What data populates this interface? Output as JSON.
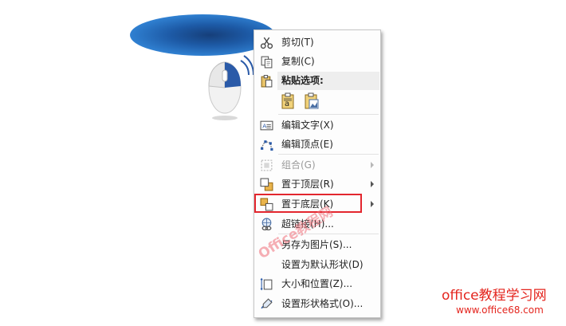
{
  "menu": {
    "items": [
      {
        "label": "剪切(T)",
        "icon": "scissors-icon",
        "enabled": true
      },
      {
        "label": "复制(C)",
        "icon": "copy-icon",
        "enabled": true
      },
      {
        "label": "粘贴选项:",
        "icon": "paste-icon"
      },
      {
        "label": "编辑文字(X)",
        "icon": "edit-text-icon",
        "enabled": true
      },
      {
        "label": "编辑顶点(E)",
        "icon": "edit-points-icon",
        "enabled": true
      },
      {
        "label": "组合(G)",
        "icon": "group-icon",
        "enabled": false,
        "submenu": true
      },
      {
        "label": "置于顶层(R)",
        "icon": "bring-to-front-icon",
        "enabled": true,
        "submenu": true
      },
      {
        "label": "置于底层(K)",
        "icon": "send-to-back-icon",
        "enabled": true,
        "submenu": true,
        "highlighted": true
      },
      {
        "label": "超链接(H)...",
        "icon": "hyperlink-icon",
        "enabled": true
      },
      {
        "label": "另存为图片(S)...",
        "icon": "",
        "enabled": true
      },
      {
        "label": "设置为默认形状(D)",
        "icon": "",
        "enabled": true
      },
      {
        "label": "大小和位置(Z)...",
        "icon": "size-position-icon",
        "enabled": true
      },
      {
        "label": "设置形状格式(O)...",
        "icon": "format-shape-icon",
        "enabled": true
      }
    ],
    "paste_options": [
      "keep-text-only-icon",
      "picture-icon"
    ]
  },
  "colors": {
    "highlight_border": "#e3262e",
    "brand": "#e4251e",
    "shape_blue": "#1d5aa6",
    "mouse_blue": "#2a5aa8"
  },
  "watermark": "Office教程网",
  "brand": {
    "title": "office教程学习网",
    "url": "www.office68.com"
  }
}
